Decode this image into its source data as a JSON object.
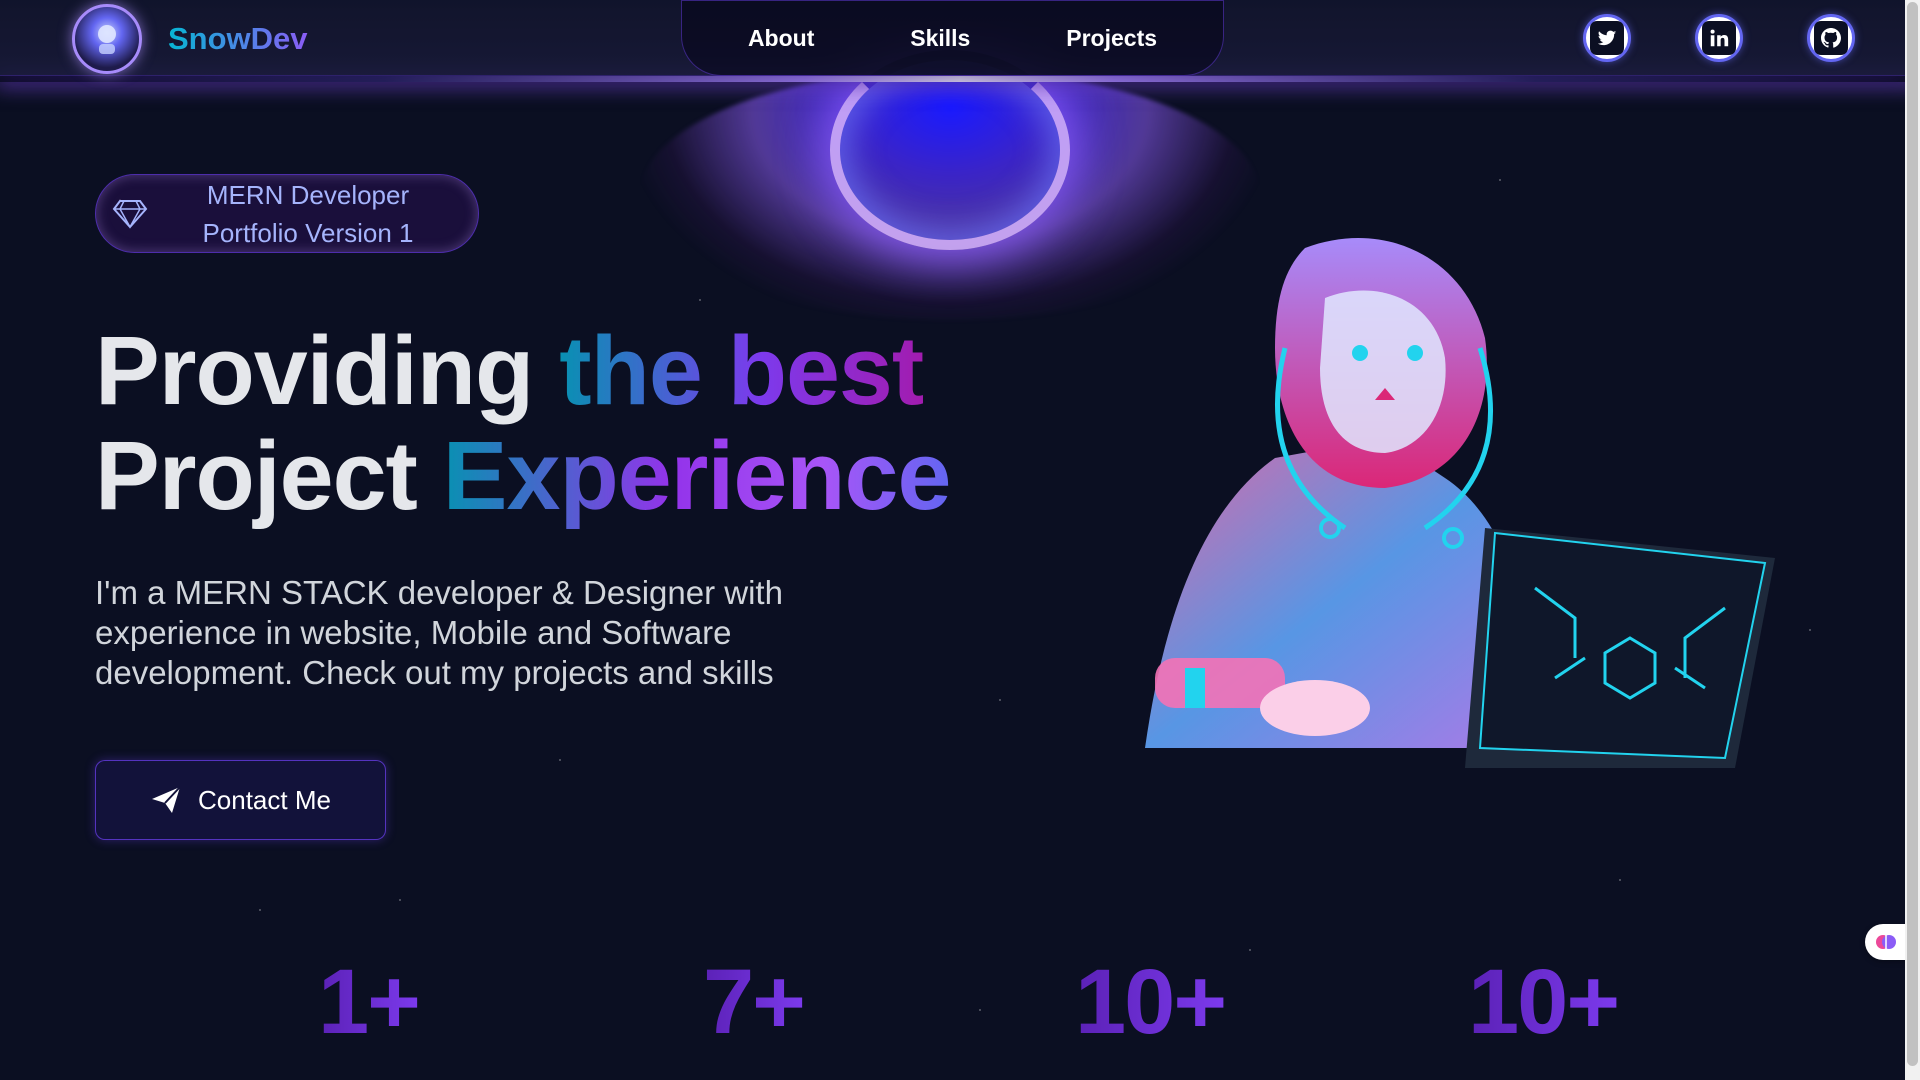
{
  "brand": {
    "name": "SnowDev"
  },
  "nav": {
    "links": [
      {
        "label": "About"
      },
      {
        "label": "Skills"
      },
      {
        "label": "Projects"
      }
    ]
  },
  "socials": [
    {
      "icon": "twitter-icon"
    },
    {
      "icon": "linkedin-icon"
    },
    {
      "icon": "github-icon"
    }
  ],
  "hero": {
    "badge_line1": "MERN Developer",
    "badge_line2": "Portfolio Version 1",
    "headline": {
      "line1_plain": "Providing",
      "line1_gradient": "the best",
      "line2_plain": "Project",
      "line2_gradient": "Experience"
    },
    "description": "I'm a MERN STACK developer & Designer with experience in website, Mobile and Software development. Check out my projects and skills",
    "contact_label": "Contact Me"
  },
  "stats": [
    {
      "value": "1+"
    },
    {
      "value": "7+"
    },
    {
      "value": "10+"
    },
    {
      "value": "10+"
    }
  ],
  "colors": {
    "background": "#0b0f22",
    "accent_cyan": "#06b6d4",
    "accent_purple": "#7c3aed",
    "accent_indigo": "#6366f1"
  }
}
